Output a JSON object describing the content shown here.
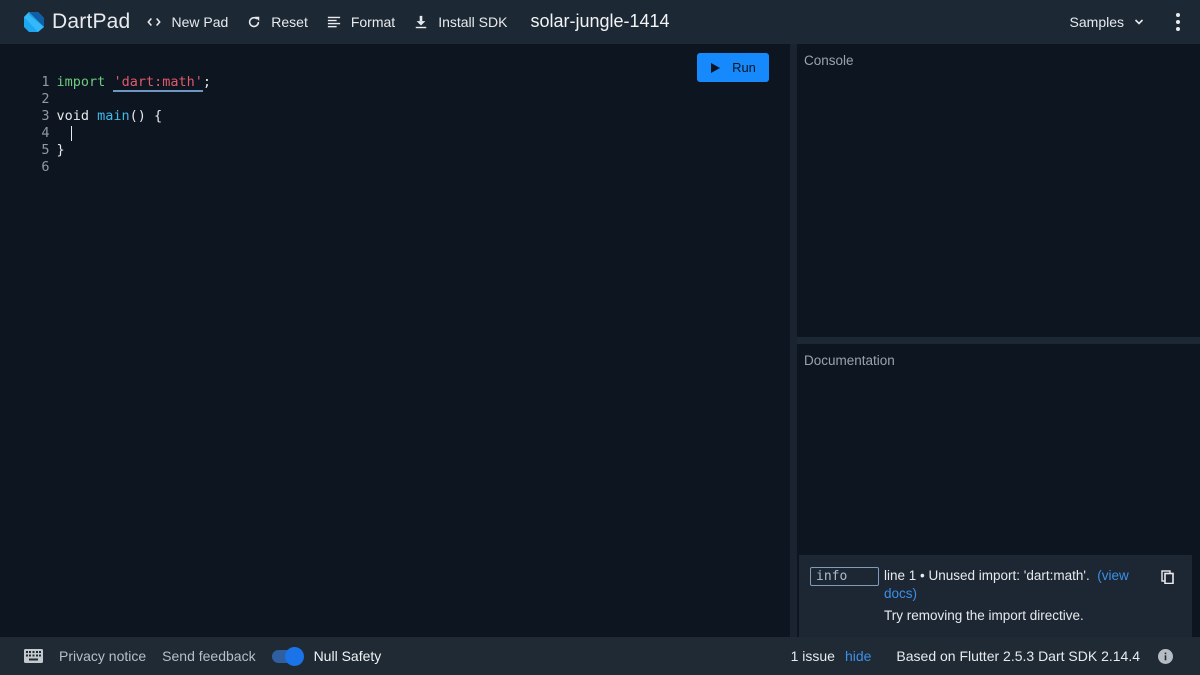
{
  "header": {
    "app_name": "DartPad",
    "pad_title": "solar-jungle-1414",
    "buttons": [
      {
        "label": "New Pad",
        "icon": "code-brackets-icon"
      },
      {
        "label": "Reset",
        "icon": "refresh-icon"
      },
      {
        "label": "Format",
        "icon": "format-lines-icon"
      },
      {
        "label": "Install SDK",
        "icon": "download-icon"
      }
    ],
    "samples_label": "Samples"
  },
  "editor": {
    "lines": [
      {
        "number": "1",
        "tokens": [
          {
            "text": "import",
            "type": "keyword"
          },
          {
            "text": " ",
            "type": "plain"
          },
          {
            "text": "'dart:math'",
            "type": "string"
          },
          {
            "text": ";",
            "type": "plain"
          }
        ]
      },
      {
        "number": "2",
        "tokens": []
      },
      {
        "number": "3",
        "tokens": [
          {
            "text": "void ",
            "type": "plain"
          },
          {
            "text": "main",
            "type": "function"
          },
          {
            "text": "() {",
            "type": "plain"
          }
        ]
      },
      {
        "number": "4",
        "tokens": []
      },
      {
        "number": "5",
        "tokens": [
          {
            "text": "}",
            "type": "plain"
          }
        ]
      },
      {
        "number": "6",
        "tokens": []
      }
    ],
    "run_label": "Run"
  },
  "console": {
    "title": "Console"
  },
  "documentation": {
    "title": "Documentation"
  },
  "issues": [
    {
      "severity": "info",
      "message": "line 1 • Unused import: 'dart:math'.",
      "link_label": "(view docs)",
      "hint": "Try removing the import directive."
    }
  ],
  "footer": {
    "privacy_label": "Privacy notice",
    "feedback_label": "Send feedback",
    "null_safety_label": "Null Safety",
    "null_safety_enabled": true,
    "issue_count": "1 issue",
    "hide_label": "hide",
    "sdk_info": "Based on Flutter 2.5.3 Dart SDK 2.14.4"
  },
  "colors": {
    "accent": "#168afd",
    "link": "#3d8fe8",
    "keyword": "#6ccb7d",
    "string": "#e0596c",
    "function": "#40b9e8"
  }
}
